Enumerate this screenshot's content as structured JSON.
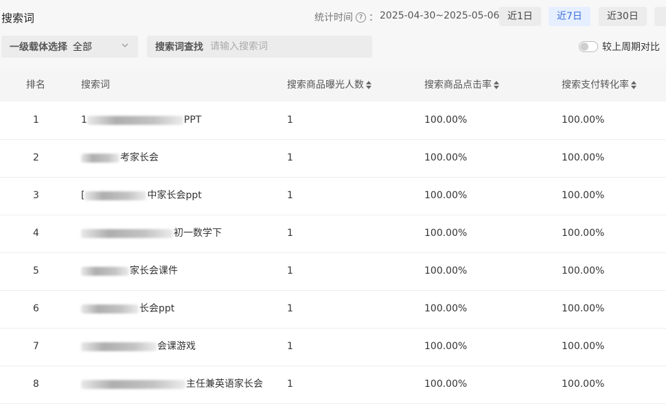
{
  "header": {
    "title": "搜索词",
    "stat_label": "统计时间",
    "help_glyph": "?",
    "colon": "：",
    "date_range": "2025-04-30~2025-05-06",
    "ranges": [
      {
        "label": "近1日",
        "active": false
      },
      {
        "label": "近7日",
        "active": true
      },
      {
        "label": "近30日",
        "active": false
      }
    ],
    "accent_color": "#3a6fd8"
  },
  "filters": {
    "carrier_label": "一级载体选择",
    "carrier_value": "全部",
    "search_label": "搜索词查找",
    "search_placeholder": "请输入搜索词",
    "compare_label": "较上周期对比",
    "compare_on": false
  },
  "table": {
    "columns": [
      "排名",
      "搜索词",
      "搜索商品曝光人数",
      "搜索商品点击率",
      "搜索支付转化率"
    ],
    "rows": [
      {
        "rank": "1",
        "lead": "1",
        "term": "PPT",
        "exposure": "1",
        "ctr": "100.00%",
        "cvr": "100.00%"
      },
      {
        "rank": "2",
        "lead": "",
        "term": "考家长会",
        "exposure": "1",
        "ctr": "100.00%",
        "cvr": "100.00%"
      },
      {
        "rank": "3",
        "lead": "[",
        "term": "中家长会ppt",
        "exposure": "1",
        "ctr": "100.00%",
        "cvr": "100.00%"
      },
      {
        "rank": "4",
        "lead": "",
        "term": "初一数学下",
        "exposure": "1",
        "ctr": "100.00%",
        "cvr": "100.00%"
      },
      {
        "rank": "5",
        "lead": "",
        "term": "家长会课件",
        "exposure": "1",
        "ctr": "100.00%",
        "cvr": "100.00%"
      },
      {
        "rank": "6",
        "lead": "",
        "term": "长会ppt",
        "exposure": "1",
        "ctr": "100.00%",
        "cvr": "100.00%"
      },
      {
        "rank": "7",
        "lead": "",
        "term": "会课游戏",
        "exposure": "1",
        "ctr": "100.00%",
        "cvr": "100.00%"
      },
      {
        "rank": "8",
        "lead": "",
        "term": "主任兼英语家长会",
        "exposure": "1",
        "ctr": "100.00%",
        "cvr": "100.00%"
      }
    ]
  }
}
